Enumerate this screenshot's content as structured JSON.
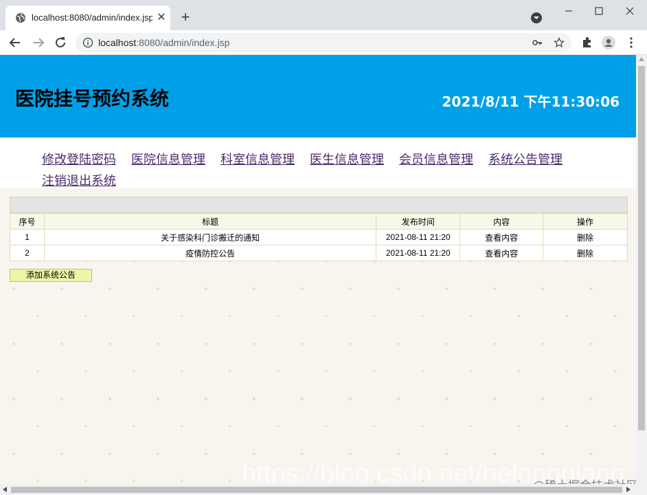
{
  "browser": {
    "tab_title": "localhost:8080/admin/index.jsp",
    "url_host": "localhost",
    "url_rest": ":8080/admin/index.jsp"
  },
  "page": {
    "site_title": "医院挂号预约系统",
    "clock": "2021/8/11 下午11:30:06",
    "menu": [
      "修改登陆密码",
      "医院信息管理",
      "科室信息管理",
      "医生信息管理",
      "会员信息管理",
      "系统公告管理",
      "注销退出系统"
    ],
    "table": {
      "headers": [
        "序号",
        "标题",
        "发布时间",
        "内容",
        "操作"
      ],
      "rows": [
        {
          "no": "1",
          "title": "关于感染科门诊搬迁的通知",
          "time": "2021-08-11 21:20",
          "view": "查看内容",
          "action": "删除"
        },
        {
          "no": "2",
          "title": "疫情防控公告",
          "time": "2021-08-11 21:20",
          "view": "查看内容",
          "action": "删除"
        }
      ]
    },
    "add_button": "添加系统公告"
  },
  "watermark": {
    "url": "https://blog.csdn.net/helongqiang",
    "label": "@稀土掘金技术社区"
  },
  "colors": {
    "banner": "#00a0e9",
    "menu_link": "#4b2a6b",
    "add_button": "#eef5a6"
  }
}
